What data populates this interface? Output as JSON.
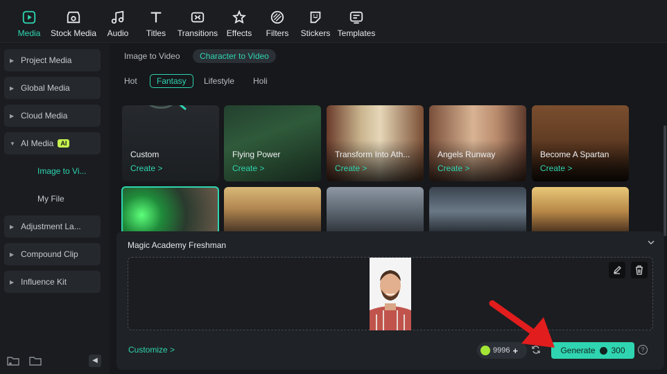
{
  "toolbar": {
    "items": [
      {
        "label": "Media",
        "icon": "media-icon",
        "active": true
      },
      {
        "label": "Stock Media",
        "icon": "stock-media-icon"
      },
      {
        "label": "Audio",
        "icon": "audio-icon"
      },
      {
        "label": "Titles",
        "icon": "titles-icon"
      },
      {
        "label": "Transitions",
        "icon": "transitions-icon"
      },
      {
        "label": "Effects",
        "icon": "effects-icon"
      },
      {
        "label": "Filters",
        "icon": "filters-icon"
      },
      {
        "label": "Stickers",
        "icon": "stickers-icon"
      },
      {
        "label": "Templates",
        "icon": "templates-icon"
      }
    ]
  },
  "sidebar": {
    "items": [
      {
        "label": "Project Media"
      },
      {
        "label": "Global Media"
      },
      {
        "label": "Cloud Media"
      },
      {
        "label": "AI Media",
        "badge": "AI",
        "expanded": true
      },
      {
        "label": "Adjustment La..."
      },
      {
        "label": "Compound Clip"
      },
      {
        "label": "Influence Kit"
      }
    ],
    "sub_items": [
      {
        "label": "Image to Vi...",
        "active": true
      },
      {
        "label": "My File"
      }
    ]
  },
  "main": {
    "tabs": [
      {
        "label": "Image to Video"
      },
      {
        "label": "Character to Video",
        "active": true
      }
    ],
    "chips": [
      {
        "label": "Hot"
      },
      {
        "label": "Fantasy",
        "active": true
      },
      {
        "label": "Lifestyle"
      },
      {
        "label": "Holi"
      }
    ],
    "cards": [
      {
        "title": "Custom",
        "action": "Create >"
      },
      {
        "title": "Flying Power",
        "action": "Create >"
      },
      {
        "title": "Transform Into Ath...",
        "action": "Create >"
      },
      {
        "title": "Angels Runway",
        "action": "Create >"
      },
      {
        "title": "Become A Spartan",
        "action": "Create >"
      }
    ]
  },
  "panel": {
    "title": "Magic Academy Freshman",
    "customize": "Customize >",
    "credits": "9996",
    "generate_label": "Generate",
    "generate_cost": "300"
  },
  "colors": {
    "accent": "#2fd5b0",
    "ai_badge": "#c6f24e",
    "arrow": "#e11d1d"
  }
}
